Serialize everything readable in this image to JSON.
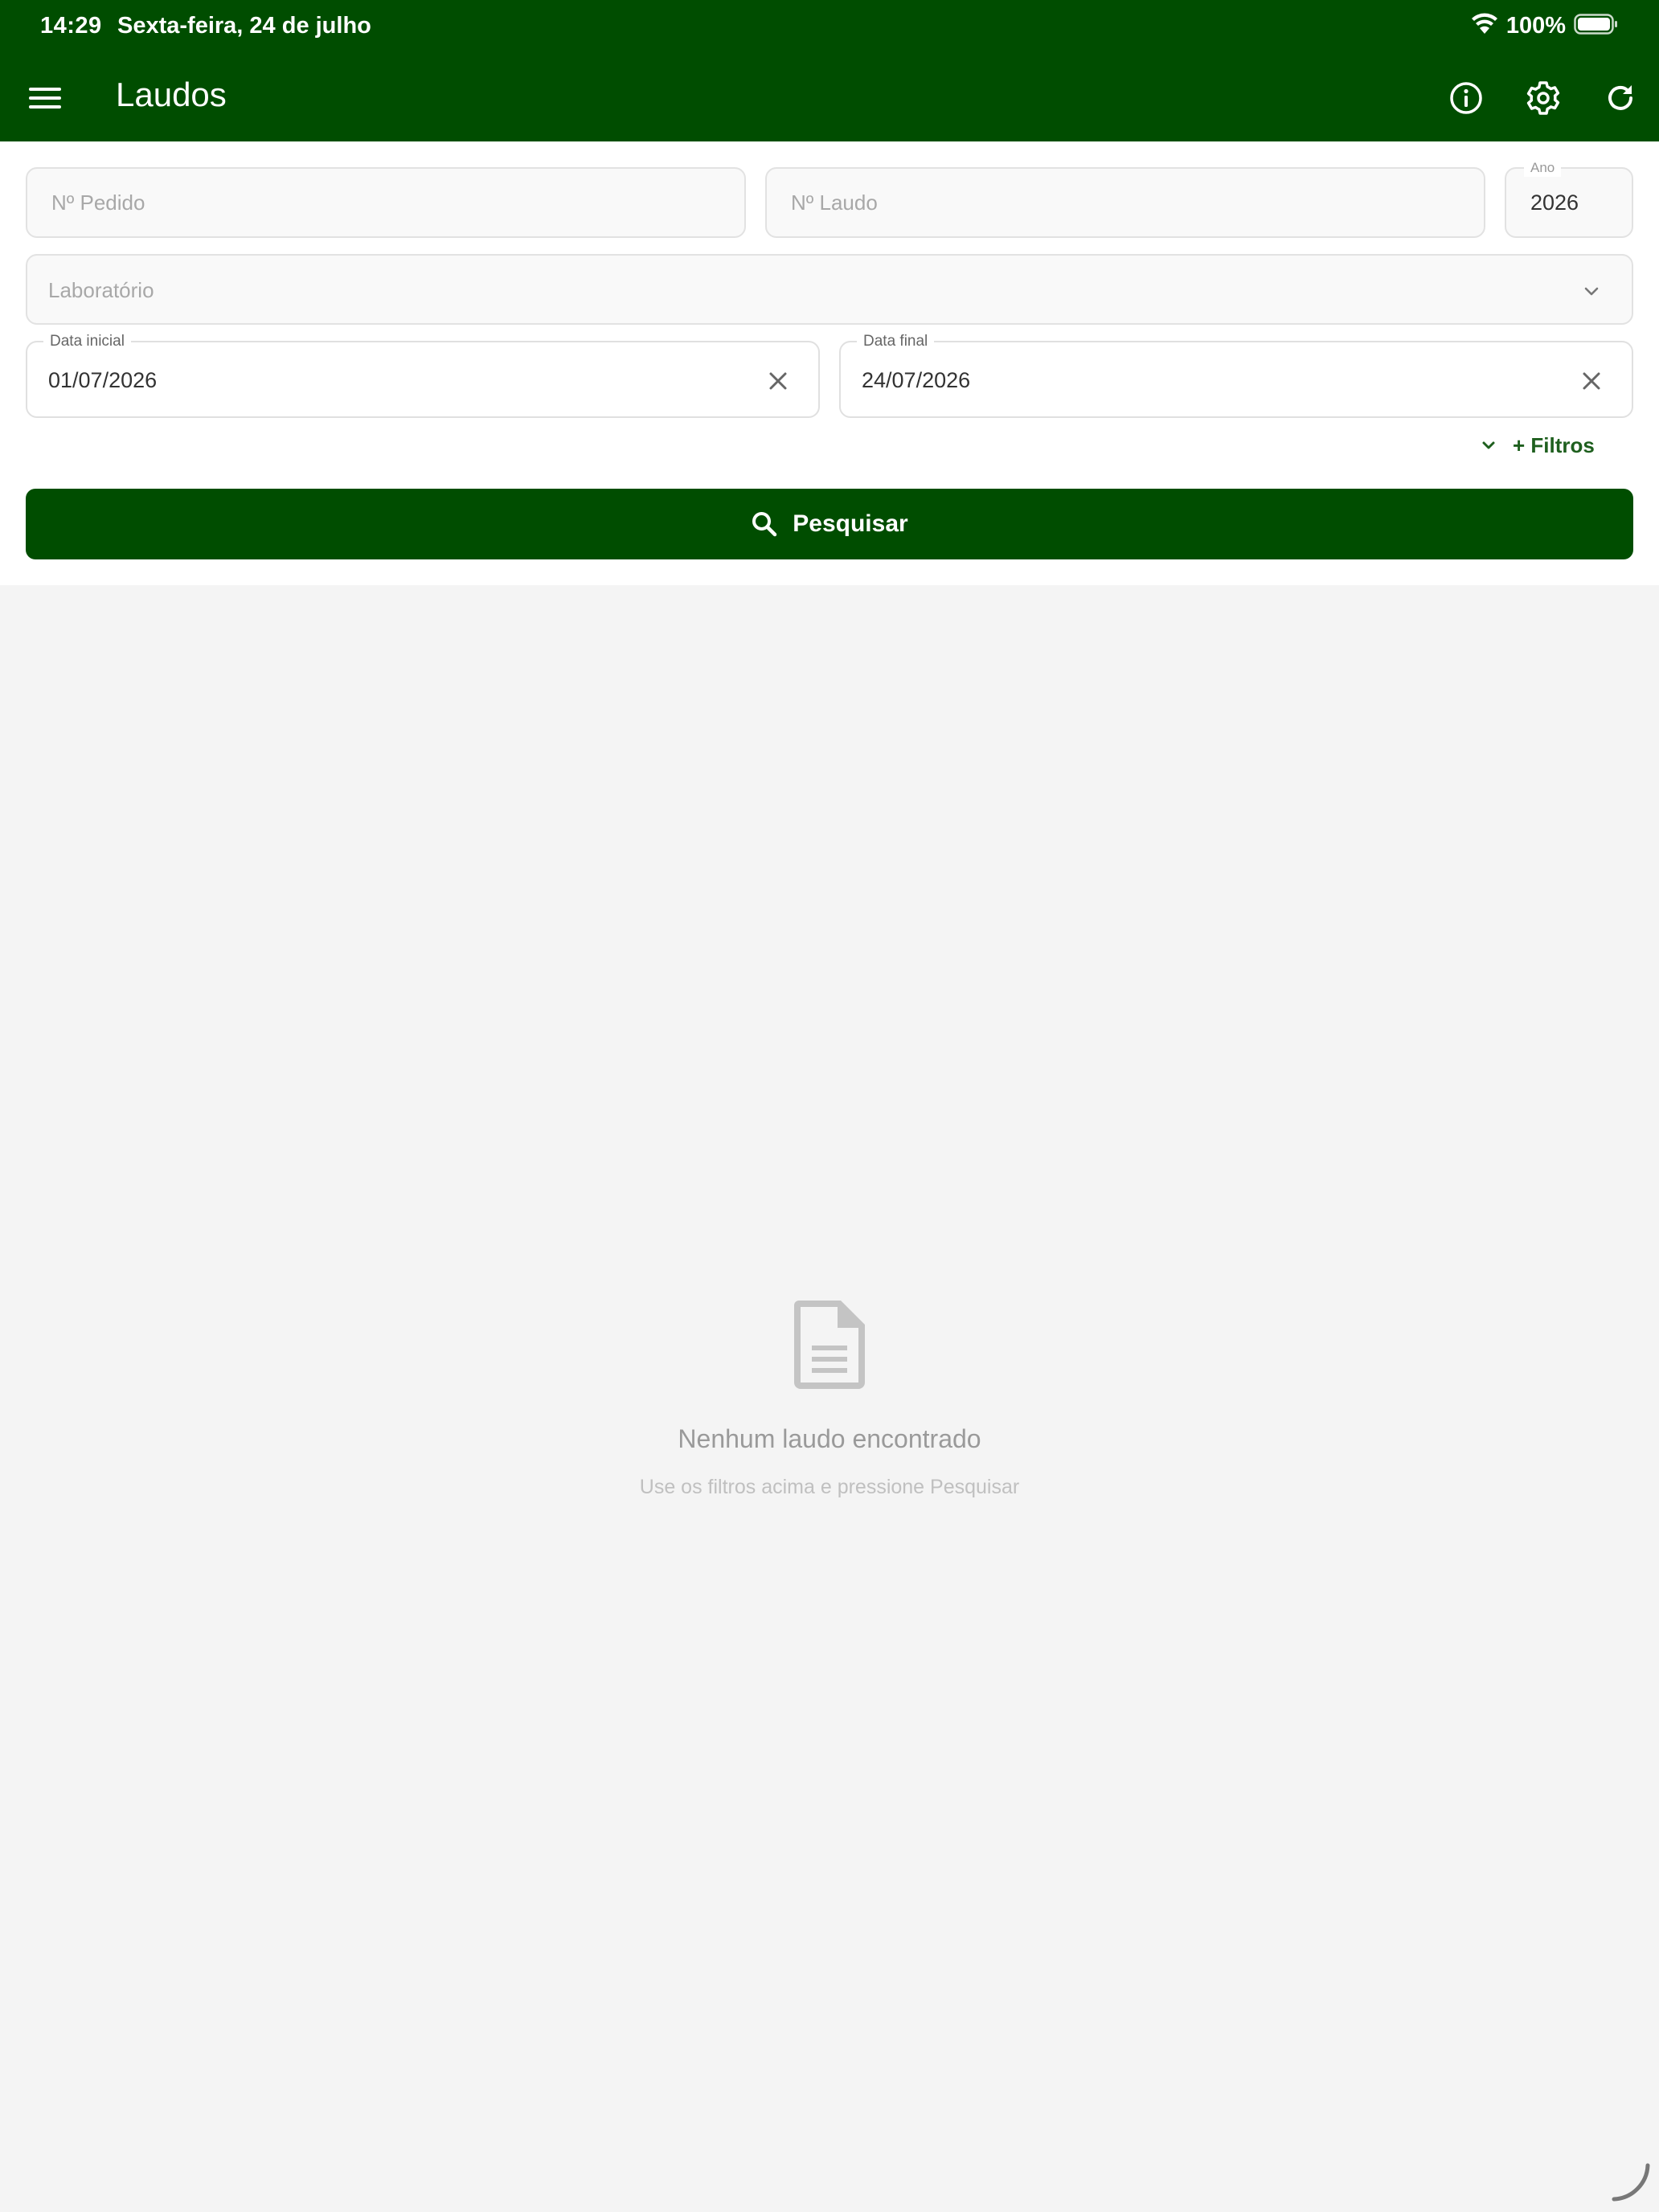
{
  "status_bar": {
    "time": "14:29",
    "date": "Sexta-feira, 24 de julho",
    "battery": "100%"
  },
  "toolbar": {
    "title": "Laudos",
    "icons": [
      "menu-icon",
      "info-icon",
      "gear-icon",
      "refresh-icon"
    ]
  },
  "filters": {
    "pedido_placeholder": "Nº Pedido",
    "laudo_placeholder": "Nº Laudo",
    "ano_label": "Ano",
    "ano_value": "2026",
    "laboratorio_placeholder": "Laboratório",
    "data_inicial_label": "Data inicial",
    "data_inicial_value": "01/07/2026",
    "data_final_label": "Data final",
    "data_final_value": "24/07/2026",
    "more_filters_label": "+ Filtros",
    "search_label": "Pesquisar"
  },
  "empty_state": {
    "title": "Nenhum laudo encontrado",
    "subtitle": "Use os filtros acima e pressione Pesquisar"
  },
  "colors": {
    "primary": "#004d00",
    "accent_text": "#1e5f1e",
    "background": "#f4f4f4"
  }
}
